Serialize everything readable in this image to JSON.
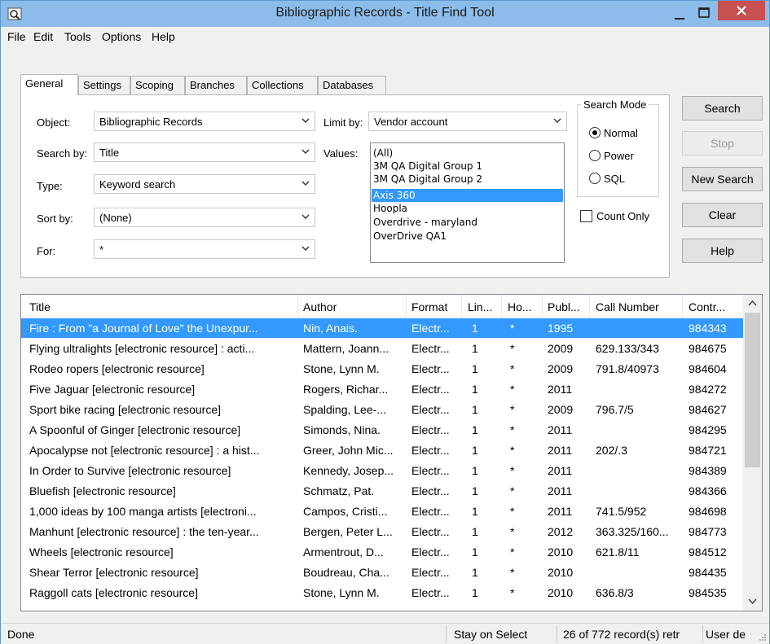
{
  "window": {
    "title": "Bibliographic Records - Title Find Tool"
  },
  "menu": [
    "File",
    "Edit",
    "Tools",
    "Options",
    "Help"
  ],
  "tabs": [
    "General",
    "Settings",
    "Scoping",
    "Branches",
    "Collections",
    "Databases"
  ],
  "active_tab": "General",
  "form": {
    "object_label": "Object:",
    "object_value": "Bibliographic Records",
    "searchby_label": "Search by:",
    "searchby_value": "Title",
    "type_label": "Type:",
    "type_value": "Keyword search",
    "sortby_label": "Sort by:",
    "sortby_value": "(None)",
    "for_label": "For:",
    "for_value": "*",
    "limitby_label": "Limit by:",
    "limitby_value": "Vendor account",
    "values_label": "Values:",
    "values_options": [
      "(All)",
      "3M QA Digital Group 1",
      "3M QA Digital Group 2",
      "Axis 360",
      "Hoopla",
      "Overdrive - maryland",
      "OverDrive QA1"
    ],
    "values_selected": "Axis 360"
  },
  "search_mode": {
    "title": "Search Mode",
    "options": [
      "Normal",
      "Power",
      "SQL"
    ],
    "selected": "Normal"
  },
  "count_only": {
    "label": "Count Only",
    "checked": false
  },
  "buttons": {
    "search": "Search",
    "stop": "Stop",
    "new_search": "New Search",
    "clear": "Clear",
    "help": "Help"
  },
  "results": {
    "columns": [
      "Title",
      "Author",
      "Format",
      "Lin...",
      "Ho...",
      "Publ...",
      "Call Number",
      "Contr..."
    ],
    "rows": [
      [
        "Fire : From \"a Journal of Love\" the Unexpur...",
        "Nin, Anais.",
        "Electr...",
        "1",
        "*",
        "1995",
        "",
        "984343"
      ],
      [
        "Flying ultralights [electronic resource] : acti...",
        "Mattern, Joann...",
        "Electr...",
        "1",
        "*",
        "2009",
        "629.133/343",
        "984675"
      ],
      [
        "Rodeo ropers [electronic resource]",
        "Stone, Lynn M.",
        "Electr...",
        "1",
        "*",
        "2009",
        "791.8/40973",
        "984604"
      ],
      [
        "Five Jaguar [electronic resource]",
        "Rogers, Richar...",
        "Electr...",
        "1",
        "*",
        "2011",
        "",
        "984272"
      ],
      [
        "Sport bike racing [electronic resource]",
        "Spalding, Lee-...",
        "Electr...",
        "1",
        "*",
        "2009",
        "796.7/5",
        "984627"
      ],
      [
        "A Spoonful of Ginger [electronic resource]",
        "Simonds, Nina.",
        "Electr...",
        "1",
        "*",
        "2011",
        "",
        "984295"
      ],
      [
        "Apocalypse not [electronic resource] : a hist...",
        "Greer, John Mic...",
        "Electr...",
        "1",
        "*",
        "2011",
        "202/.3",
        "984721"
      ],
      [
        "In Order to Survive [electronic resource]",
        "Kennedy, Josep...",
        "Electr...",
        "1",
        "*",
        "2011",
        "",
        "984389"
      ],
      [
        "Bluefish [electronic resource]",
        "Schmatz, Pat.",
        "Electr...",
        "1",
        "*",
        "2011",
        "",
        "984366"
      ],
      [
        "1,000 ideas by 100 manga artists [electroni...",
        "Campos, Cristi...",
        "Electr...",
        "1",
        "*",
        "2011",
        "741.5/952",
        "984698"
      ],
      [
        "Manhunt [electronic resource] : the ten-year...",
        "Bergen, Peter L...",
        "Electr...",
        "1",
        "*",
        "2012",
        "363.325/160...",
        "984773"
      ],
      [
        "Wheels [electronic resource]",
        "Armentrout, D...",
        "Electr...",
        "1",
        "*",
        "2010",
        "621.8/11",
        "984512"
      ],
      [
        "Shear Terror [electronic resource]",
        "Boudreau, Cha...",
        "Electr...",
        "1",
        "*",
        "2010",
        "",
        "984435"
      ],
      [
        "Raggoll cats [electronic resource]",
        "Stone, Lynn M.",
        "Electr...",
        "1",
        "*",
        "2010",
        "636.8/3",
        "984535"
      ]
    ]
  },
  "status": {
    "left": "Done",
    "mode": "Stay on Select",
    "records": "26 of 772 record(s) retr",
    "user": "User de"
  }
}
